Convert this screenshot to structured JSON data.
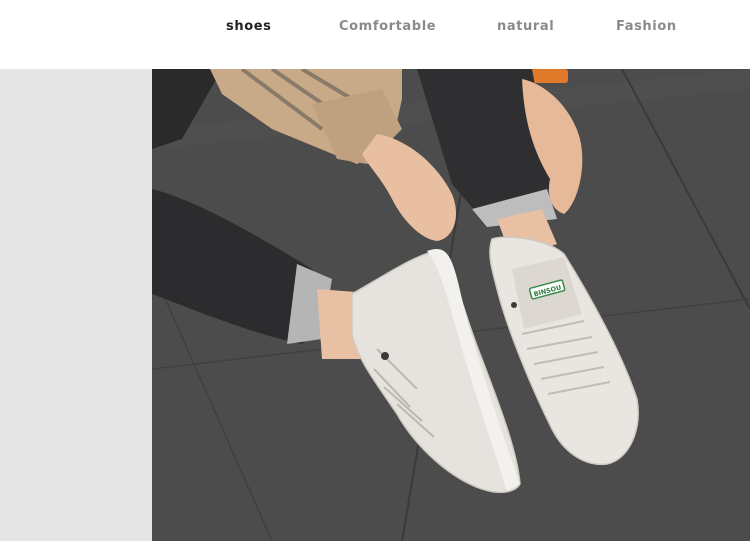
{
  "nav": {
    "items": [
      {
        "label": "shoes",
        "active": true
      },
      {
        "label": "Comfortable",
        "active": false
      },
      {
        "label": "natural",
        "active": false
      },
      {
        "label": "Fashion",
        "active": false
      }
    ]
  },
  "product_image": {
    "tongue_label_text": "BINSOU"
  },
  "colors": {
    "active_tab": "#222222",
    "inactive_tab": "#8a8a8a",
    "left_panel": "#e6e6e6",
    "tile": "#4a4a4a",
    "shoe": "#e9e6e1"
  }
}
